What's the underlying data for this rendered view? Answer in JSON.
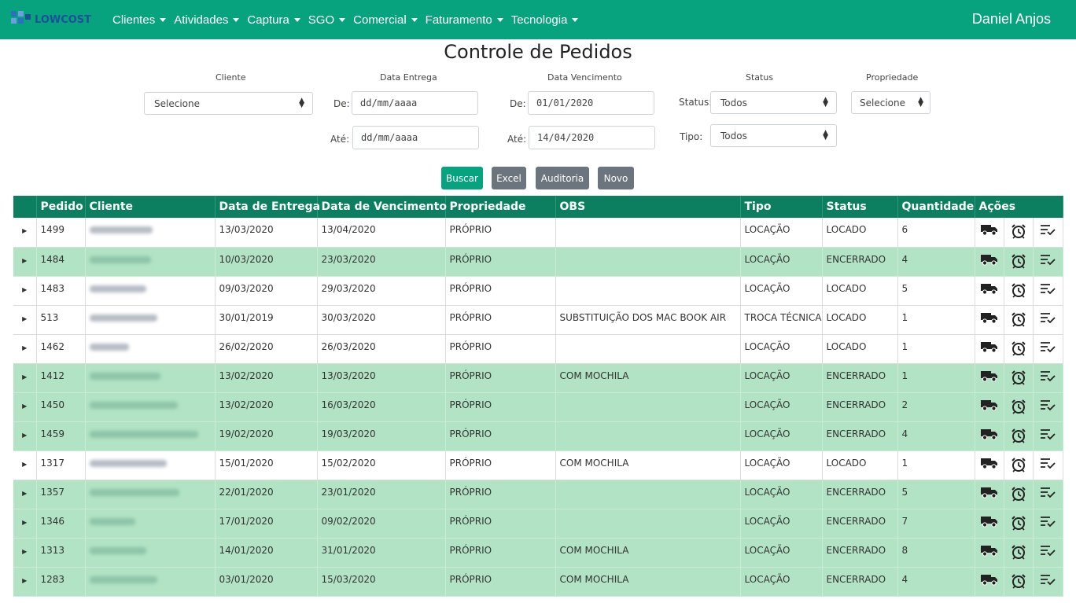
{
  "app": {
    "logo_text": "LOWCOST",
    "user": "Daniel Anjos",
    "colors": {
      "brand": "#07a37f",
      "header": "#0b7f5f",
      "row_green": "#b1e3c4"
    }
  },
  "nav": [
    {
      "label": "Clientes"
    },
    {
      "label": "Atividades"
    },
    {
      "label": "Captura"
    },
    {
      "label": "SGO"
    },
    {
      "label": "Comercial"
    },
    {
      "label": "Faturamento"
    },
    {
      "label": "Tecnologia"
    }
  ],
  "page_title": "Controle de Pedidos",
  "filters": {
    "cliente": {
      "label": "Cliente",
      "value": "Selecione"
    },
    "data_entrega": {
      "label": "Data Entrega",
      "de_label": "De:",
      "ate_label": "Até:",
      "de_placeholder": "dd/mm/aaaa",
      "ate_placeholder": "dd/mm/aaaa"
    },
    "data_vencimento": {
      "label": "Data Vencimento",
      "de_label": "De:",
      "ate_label": "Até:",
      "de_value": "01/01/2020",
      "ate_value": "14/04/2020"
    },
    "status": {
      "label": "Status",
      "status_label": "Status:",
      "status_value": "Todos",
      "tipo_label": "Tipo:",
      "tipo_value": "Todos"
    },
    "propriedade": {
      "label": "Propriedade",
      "value": "Selecione"
    }
  },
  "buttons": {
    "buscar": "Buscar",
    "excel": "Excel",
    "auditoria": "Auditoria",
    "novo": "Novo"
  },
  "table": {
    "headers": [
      "Pedido",
      "Cliente",
      "Data de Entrega",
      "Data de Vencimento",
      "Propriedade",
      "OBS",
      "Tipo",
      "Status",
      "Quantidade",
      "Ações"
    ],
    "action_icons": [
      "truck-icon",
      "alarm-clock-icon",
      "checklist-icon"
    ],
    "rows": [
      {
        "pedido": "1499",
        "entrega": "13/03/2020",
        "vencimento": "13/04/2020",
        "propriedade": "PRÓPRIO",
        "obs": "",
        "tipo": "LOCAÇÃO",
        "status": "LOCADO",
        "quantidade": "6"
      },
      {
        "pedido": "1484",
        "entrega": "10/03/2020",
        "vencimento": "23/03/2020",
        "propriedade": "PRÓPRIO",
        "obs": "",
        "tipo": "LOCAÇÃO",
        "status": "ENCERRADO",
        "quantidade": "4"
      },
      {
        "pedido": "1483",
        "entrega": "09/03/2020",
        "vencimento": "29/03/2020",
        "propriedade": "PRÓPRIO",
        "obs": "",
        "tipo": "LOCAÇÃO",
        "status": "LOCADO",
        "quantidade": "5"
      },
      {
        "pedido": "513",
        "entrega": "30/01/2019",
        "vencimento": "30/03/2020",
        "propriedade": "PRÓPRIO",
        "obs": "SUBSTITUIÇÃO DOS MAC BOOK AIR",
        "tipo": "TROCA TÉCNICA",
        "status": "LOCADO",
        "quantidade": "1"
      },
      {
        "pedido": "1462",
        "entrega": "26/02/2020",
        "vencimento": "26/03/2020",
        "propriedade": "PRÓPRIO",
        "obs": "",
        "tipo": "LOCAÇÃO",
        "status": "LOCADO",
        "quantidade": "1"
      },
      {
        "pedido": "1412",
        "entrega": "13/02/2020",
        "vencimento": "13/03/2020",
        "propriedade": "PRÓPRIO",
        "obs": "COM MOCHILA",
        "tipo": "LOCAÇÃO",
        "status": "ENCERRADO",
        "quantidade": "1"
      },
      {
        "pedido": "1450",
        "entrega": "13/02/2020",
        "vencimento": "16/03/2020",
        "propriedade": "PRÓPRIO",
        "obs": "",
        "tipo": "LOCAÇÃO",
        "status": "ENCERRADO",
        "quantidade": "2"
      },
      {
        "pedido": "1459",
        "entrega": "19/02/2020",
        "vencimento": "19/03/2020",
        "propriedade": "PRÓPRIO",
        "obs": "",
        "tipo": "LOCAÇÃO",
        "status": "ENCERRADO",
        "quantidade": "4"
      },
      {
        "pedido": "1317",
        "entrega": "15/01/2020",
        "vencimento": "15/02/2020",
        "propriedade": "PRÓPRIO",
        "obs": "COM MOCHILA",
        "tipo": "LOCAÇÃO",
        "status": "LOCADO",
        "quantidade": "1"
      },
      {
        "pedido": "1357",
        "entrega": "22/01/2020",
        "vencimento": "23/01/2020",
        "propriedade": "PRÓPRIO",
        "obs": "",
        "tipo": "LOCAÇÃO",
        "status": "ENCERRADO",
        "quantidade": "5"
      },
      {
        "pedido": "1346",
        "entrega": "17/01/2020",
        "vencimento": "09/02/2020",
        "propriedade": "PRÓPRIO",
        "obs": "",
        "tipo": "LOCAÇÃO",
        "status": "ENCERRADO",
        "quantidade": "7"
      },
      {
        "pedido": "1313",
        "entrega": "14/01/2020",
        "vencimento": "31/01/2020",
        "propriedade": "PRÓPRIO",
        "obs": "COM MOCHILA",
        "tipo": "LOCAÇÃO",
        "status": "ENCERRADO",
        "quantidade": "8"
      },
      {
        "pedido": "1283",
        "entrega": "03/01/2020",
        "vencimento": "15/03/2020",
        "propriedade": "PRÓPRIO",
        "obs": "COM MOCHILA",
        "tipo": "LOCAÇÃO",
        "status": "ENCERRADO",
        "quantidade": "4"
      }
    ]
  }
}
